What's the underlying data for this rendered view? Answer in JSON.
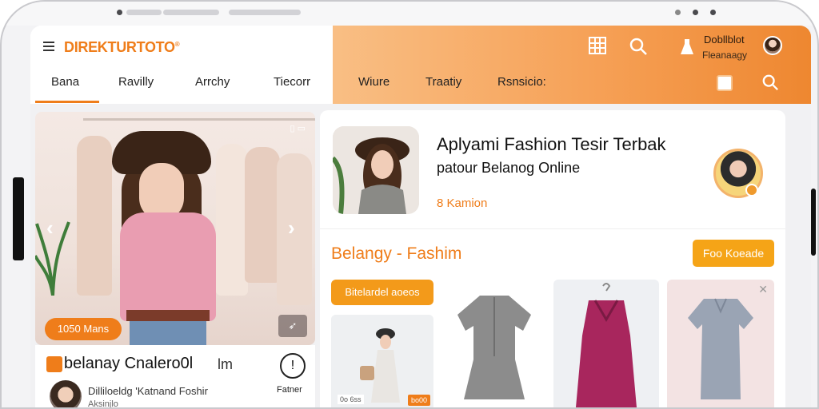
{
  "header": {
    "logo": "DIREKTURTOTO",
    "logo_mark": "®",
    "tabs": [
      "Bana",
      "Ravilly",
      "Arrchy",
      "Tiecorr",
      "Wiure",
      "Traatiy",
      "Rsnsicio:"
    ],
    "user_name": "Dobllblot",
    "user_subtitle": "Fleanaagy"
  },
  "hero": {
    "badge": "1050 Mans"
  },
  "left_bottom": {
    "title": "belanay Cnalero0l",
    "mark": "lm",
    "circle_label": "Fatner",
    "subtitle": "Dilliloeldg 'Katnand Foshir",
    "subtitle2": "Aksinjlo"
  },
  "feature": {
    "title": "Aplyami Fashion Tesir Terbak",
    "subtitle": "patour Belanog Online",
    "small_label": "8 Kamion"
  },
  "section": {
    "title": "Belangy - Fashim",
    "button": "Foo Koeade",
    "chip": "Bitelardel aoeos"
  },
  "products": {
    "p1_label": "0o 6ss",
    "p1_tag": "bo00"
  },
  "colors": {
    "accent": "#ef7d1a",
    "header_gradient_start": "#f9bf85",
    "header_gradient_end": "#ee8730",
    "button": "#f5a417"
  },
  "icons": [
    "hamburger-icon",
    "grid-icon",
    "search-icon",
    "flask-icon",
    "camera-icon",
    "chevron-left-icon",
    "chevron-right-icon",
    "info-icon"
  ]
}
